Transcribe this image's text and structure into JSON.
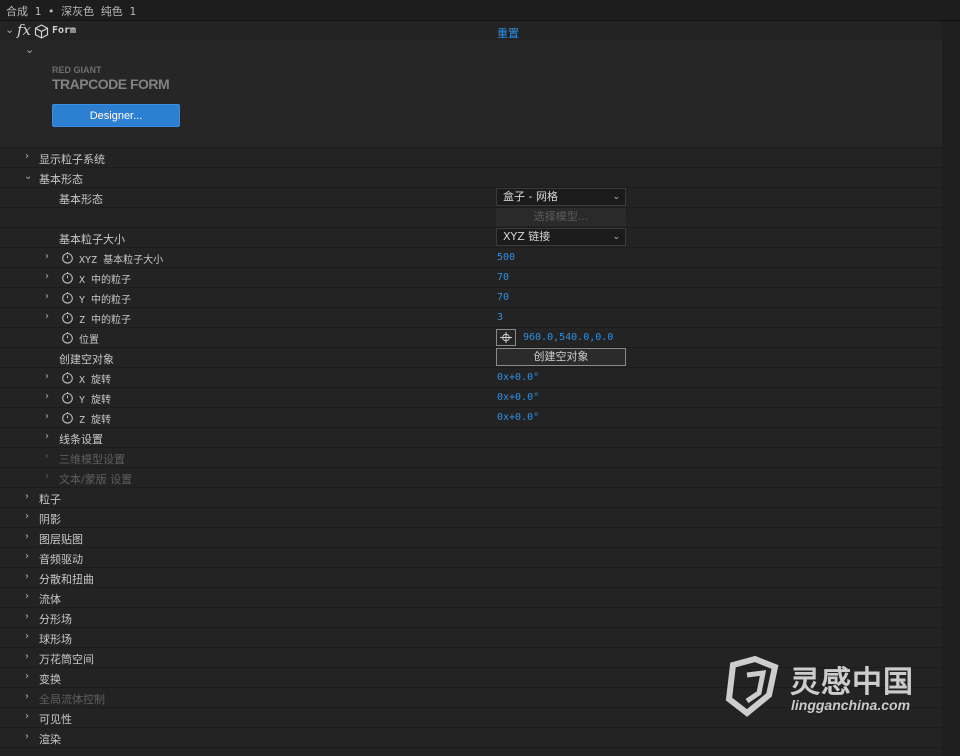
{
  "breadcrumb": "合成 1 • 深灰色 纯色 1",
  "effect": {
    "fx_label": "fx",
    "name": "Form",
    "reset_label": "重置",
    "logo_line1": "RED GIANT",
    "logo_line2": "TRAPCODE FORM",
    "designer_label": "Designer..."
  },
  "rows": {
    "show_particle_system": "显示粒子系统",
    "base_form_group": "基本形态",
    "base_form": "基本形态",
    "base_form_value": "盒子 - 网格",
    "select_model": "选择模型...",
    "base_particle_size": "基本粒子大小",
    "base_particle_size_value": "XYZ 链接",
    "xyz_size": "XYZ 基本粒子大小",
    "xyz_size_value": "500",
    "particles_in_x": "X 中的粒子",
    "particles_in_x_value": "70",
    "particles_in_y": "Y 中的粒子",
    "particles_in_y_value": "70",
    "particles_in_z": "Z 中的粒子",
    "particles_in_z_value": "3",
    "position": "位置",
    "position_value": "960.0,540.0,0.0",
    "create_null": "创建空对象",
    "create_null_button": "创建空对象",
    "x_rotation": "X 旋转",
    "x_rotation_value": "0x+0.0°",
    "y_rotation": "Y 旋转",
    "y_rotation_value": "0x+0.0°",
    "z_rotation": "Z 旋转",
    "z_rotation_value": "0x+0.0°",
    "string_settings": "线条设置",
    "obj_settings": "三维模型设置",
    "text_mask_settings": "文本/蒙版 设置"
  },
  "sections": [
    "粒子",
    "阴影",
    "图层贴图",
    "音频驱动",
    "分散和扭曲",
    "流体",
    "分形场",
    "球形场",
    "万花筒空间",
    "变换",
    "全局流体控制",
    "可见性",
    "渲染"
  ],
  "watermark": {
    "brand": "灵感中国",
    "url": "lingganchina.com"
  },
  "colors": {
    "accent": "#2f8fe0",
    "button": "#2d7fd1",
    "background": "#232323"
  }
}
